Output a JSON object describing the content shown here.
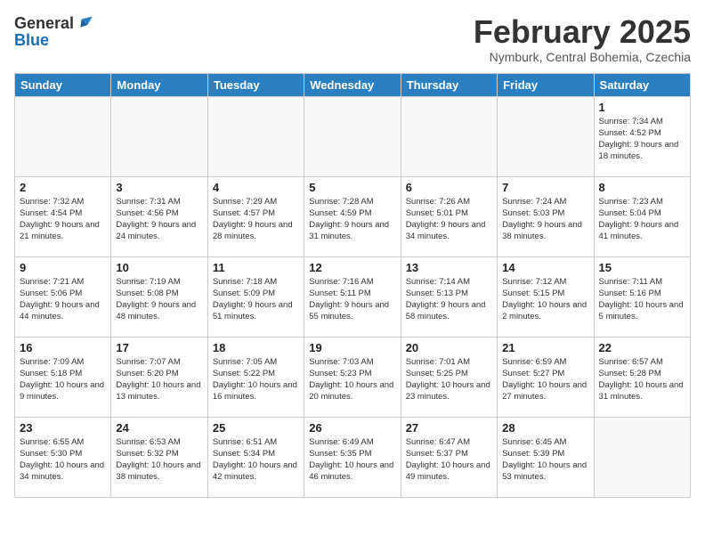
{
  "header": {
    "logo_general": "General",
    "logo_blue": "Blue",
    "month": "February 2025",
    "location": "Nymburk, Central Bohemia, Czechia"
  },
  "weekdays": [
    "Sunday",
    "Monday",
    "Tuesday",
    "Wednesday",
    "Thursday",
    "Friday",
    "Saturday"
  ],
  "weeks": [
    [
      {
        "day": "",
        "info": ""
      },
      {
        "day": "",
        "info": ""
      },
      {
        "day": "",
        "info": ""
      },
      {
        "day": "",
        "info": ""
      },
      {
        "day": "",
        "info": ""
      },
      {
        "day": "",
        "info": ""
      },
      {
        "day": "1",
        "info": "Sunrise: 7:34 AM\nSunset: 4:52 PM\nDaylight: 9 hours and 18 minutes."
      }
    ],
    [
      {
        "day": "2",
        "info": "Sunrise: 7:32 AM\nSunset: 4:54 PM\nDaylight: 9 hours and 21 minutes."
      },
      {
        "day": "3",
        "info": "Sunrise: 7:31 AM\nSunset: 4:56 PM\nDaylight: 9 hours and 24 minutes."
      },
      {
        "day": "4",
        "info": "Sunrise: 7:29 AM\nSunset: 4:57 PM\nDaylight: 9 hours and 28 minutes."
      },
      {
        "day": "5",
        "info": "Sunrise: 7:28 AM\nSunset: 4:59 PM\nDaylight: 9 hours and 31 minutes."
      },
      {
        "day": "6",
        "info": "Sunrise: 7:26 AM\nSunset: 5:01 PM\nDaylight: 9 hours and 34 minutes."
      },
      {
        "day": "7",
        "info": "Sunrise: 7:24 AM\nSunset: 5:03 PM\nDaylight: 9 hours and 38 minutes."
      },
      {
        "day": "8",
        "info": "Sunrise: 7:23 AM\nSunset: 5:04 PM\nDaylight: 9 hours and 41 minutes."
      }
    ],
    [
      {
        "day": "9",
        "info": "Sunrise: 7:21 AM\nSunset: 5:06 PM\nDaylight: 9 hours and 44 minutes."
      },
      {
        "day": "10",
        "info": "Sunrise: 7:19 AM\nSunset: 5:08 PM\nDaylight: 9 hours and 48 minutes."
      },
      {
        "day": "11",
        "info": "Sunrise: 7:18 AM\nSunset: 5:09 PM\nDaylight: 9 hours and 51 minutes."
      },
      {
        "day": "12",
        "info": "Sunrise: 7:16 AM\nSunset: 5:11 PM\nDaylight: 9 hours and 55 minutes."
      },
      {
        "day": "13",
        "info": "Sunrise: 7:14 AM\nSunset: 5:13 PM\nDaylight: 9 hours and 58 minutes."
      },
      {
        "day": "14",
        "info": "Sunrise: 7:12 AM\nSunset: 5:15 PM\nDaylight: 10 hours and 2 minutes."
      },
      {
        "day": "15",
        "info": "Sunrise: 7:11 AM\nSunset: 5:16 PM\nDaylight: 10 hours and 5 minutes."
      }
    ],
    [
      {
        "day": "16",
        "info": "Sunrise: 7:09 AM\nSunset: 5:18 PM\nDaylight: 10 hours and 9 minutes."
      },
      {
        "day": "17",
        "info": "Sunrise: 7:07 AM\nSunset: 5:20 PM\nDaylight: 10 hours and 13 minutes."
      },
      {
        "day": "18",
        "info": "Sunrise: 7:05 AM\nSunset: 5:22 PM\nDaylight: 10 hours and 16 minutes."
      },
      {
        "day": "19",
        "info": "Sunrise: 7:03 AM\nSunset: 5:23 PM\nDaylight: 10 hours and 20 minutes."
      },
      {
        "day": "20",
        "info": "Sunrise: 7:01 AM\nSunset: 5:25 PM\nDaylight: 10 hours and 23 minutes."
      },
      {
        "day": "21",
        "info": "Sunrise: 6:59 AM\nSunset: 5:27 PM\nDaylight: 10 hours and 27 minutes."
      },
      {
        "day": "22",
        "info": "Sunrise: 6:57 AM\nSunset: 5:28 PM\nDaylight: 10 hours and 31 minutes."
      }
    ],
    [
      {
        "day": "23",
        "info": "Sunrise: 6:55 AM\nSunset: 5:30 PM\nDaylight: 10 hours and 34 minutes."
      },
      {
        "day": "24",
        "info": "Sunrise: 6:53 AM\nSunset: 5:32 PM\nDaylight: 10 hours and 38 minutes."
      },
      {
        "day": "25",
        "info": "Sunrise: 6:51 AM\nSunset: 5:34 PM\nDaylight: 10 hours and 42 minutes."
      },
      {
        "day": "26",
        "info": "Sunrise: 6:49 AM\nSunset: 5:35 PM\nDaylight: 10 hours and 46 minutes."
      },
      {
        "day": "27",
        "info": "Sunrise: 6:47 AM\nSunset: 5:37 PM\nDaylight: 10 hours and 49 minutes."
      },
      {
        "day": "28",
        "info": "Sunrise: 6:45 AM\nSunset: 5:39 PM\nDaylight: 10 hours and 53 minutes."
      },
      {
        "day": "",
        "info": ""
      }
    ]
  ]
}
